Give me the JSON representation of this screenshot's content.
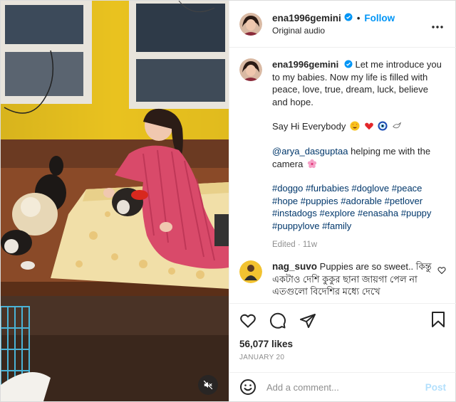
{
  "header": {
    "username": "ena1996gemini",
    "separator": "•",
    "follow_label": "Follow",
    "subtitle": "Original audio",
    "more_icon": "more-options-icon"
  },
  "caption": {
    "username": "ena1996gemini",
    "line1": "Let me introduce you to my babies. Now my life is filled with peace, love, true, dream, luck, believe and hope.",
    "line2": "Say Hi Everybody",
    "line2_emojis": [
      "star-struck-emoji",
      "red-heart-emoji",
      "nazar-amulet-emoji",
      "dove-emoji"
    ],
    "mention": "@arya_dasguptaa",
    "mention_text": "helping me with the camera",
    "mention_emoji": "cherry-blossom-emoji",
    "hashtags": [
      "#doggo",
      "#furbabies",
      "#doglove",
      "#peace",
      "#hope",
      "#puppies",
      "#adorable",
      "#petlover",
      "#instadogs",
      "#explore",
      "#enasaha",
      "#puppy",
      "#puppylove",
      "#family"
    ],
    "edited": "Edited",
    "time": "11w"
  },
  "comment": {
    "username": "nag_suvo",
    "text": "Puppies are so sweet.. কিন্তু একটাও দেশি কুকুর ছানা জায়গা পেল না এতগুলো বিদেশির মধ্যে দেখে"
  },
  "actions": {
    "likes": "56,077 likes",
    "date": "JANUARY 20"
  },
  "add_comment": {
    "placeholder": "Add a comment...",
    "post_label": "Post"
  },
  "colors": {
    "accent": "#0095f6",
    "link": "#00376b",
    "muted": "#8e8e8e",
    "post_disabled": "#b2dffc",
    "border": "#dbdbdb"
  }
}
